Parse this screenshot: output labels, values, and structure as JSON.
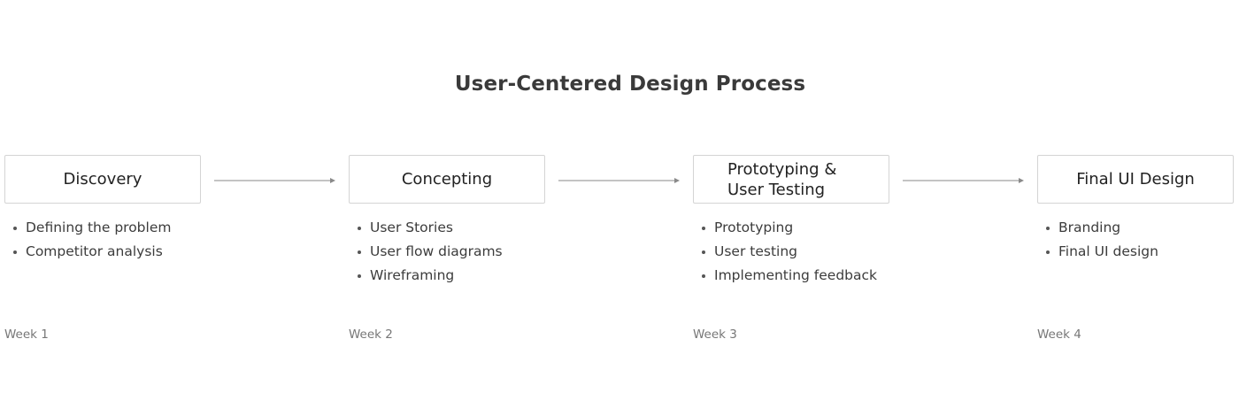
{
  "title": "User-Centered Design Process",
  "stages": [
    {
      "name": "Discovery",
      "items": [
        "Defining the problem",
        "Competitor analysis"
      ],
      "week": "Week 1"
    },
    {
      "name": "Concepting",
      "items": [
        "User Stories",
        "User flow diagrams",
        "Wireframing"
      ],
      "week": "Week 2"
    },
    {
      "name_lines": [
        "Prototyping &",
        "User Testing"
      ],
      "items": [
        "Prototyping",
        "User testing",
        "Implementing feedback"
      ],
      "week": "Week 3"
    },
    {
      "name": "Final UI Design",
      "items": [
        "Branding",
        "Final UI design"
      ],
      "week": "Week 4"
    }
  ],
  "colors": {
    "box_border": "#d4d4d4",
    "arrow": "#8a8a8a",
    "text": "#333333",
    "muted": "#777777"
  }
}
